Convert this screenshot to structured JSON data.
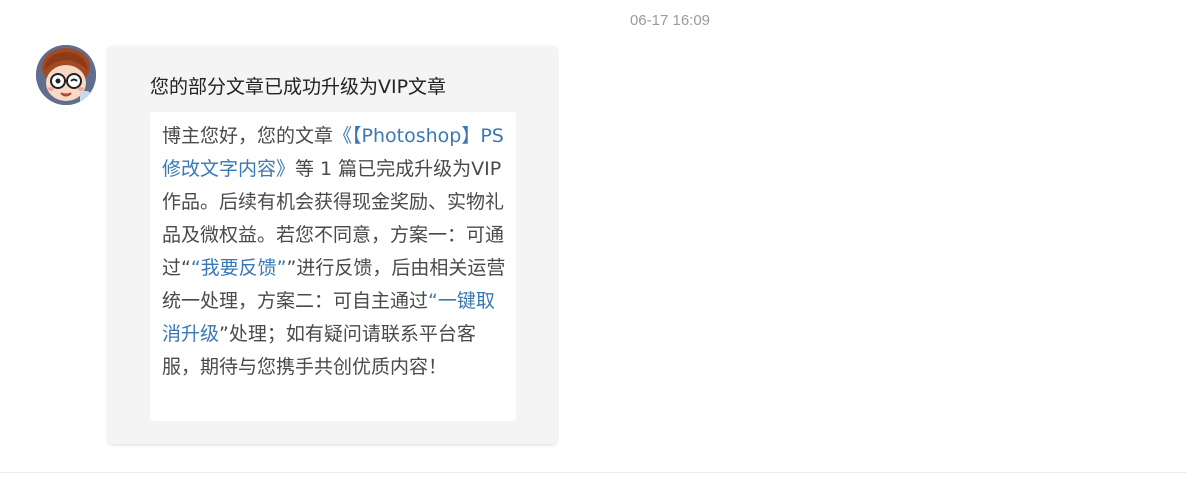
{
  "timestamp": "06-17 16:09",
  "message": {
    "title": "您的部分文章已成功升级为VIP文章",
    "body_parts": {
      "p1": "博主您好，您的文章",
      "article_link": "《【Photoshop】PS修改文字内容》",
      "p2": "等 1 篇已完成升级为VIP作品。后续有机会获得现金奖励、实物礼品及微权益。若您不同意，方案一：可通过“",
      "feedback_link": "“我要反馈”",
      "p3": "”进行反馈，后由相关运营统一处理，方案二：可自主通过",
      "cancel_link": "“一键取消升级",
      "p4": "”处理；如有疑问请联系平台客服，期待与您携手共创优质内容！"
    }
  },
  "colors": {
    "link": "#3a78b5",
    "bubble_bg": "#f4f4f4",
    "text": "#4a4a4a",
    "timestamp": "#9b9b9b"
  },
  "icons": {
    "avatar": "cartoon-avatar-with-glasses"
  }
}
